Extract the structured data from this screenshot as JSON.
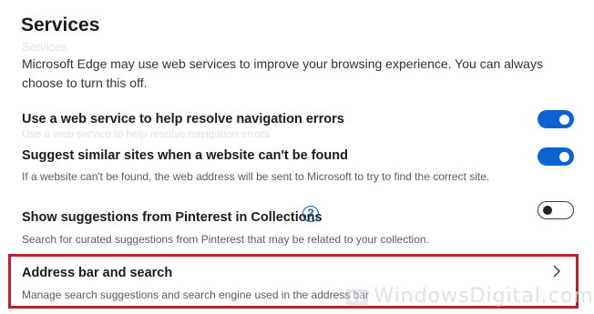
{
  "section": {
    "title": "Services",
    "description": "Microsoft Edge may use web services to improve your browsing experience. You can always choose to turn this off."
  },
  "settings": [
    {
      "label": "Use a web service to help resolve navigation errors",
      "sub": "",
      "toggle": "on"
    },
    {
      "label": "Suggest similar sites when a website can't be found",
      "sub": "If a website can't be found, the web address will be sent to Microsoft to try to find the correct site.",
      "toggle": "on"
    },
    {
      "label": "Show suggestions from Pinterest in Collections",
      "sub": "Search for curated suggestions from Pinterest that may be related to your collection.",
      "toggle": "off",
      "help_icon": "?"
    }
  ],
  "address_bar": {
    "label": "Address bar and search",
    "sub": "Manage search suggestions and search engine used in the address bar",
    "chevron_icon": "chevron-right-icon"
  },
  "ghost_text": {
    "line1": "Services",
    "line2": "Use a web service to help resolve navigation errors"
  },
  "watermark": "WindowsDigital.com",
  "colors": {
    "toggle_on": "#0b63d3",
    "highlight_border": "#b8232c"
  }
}
